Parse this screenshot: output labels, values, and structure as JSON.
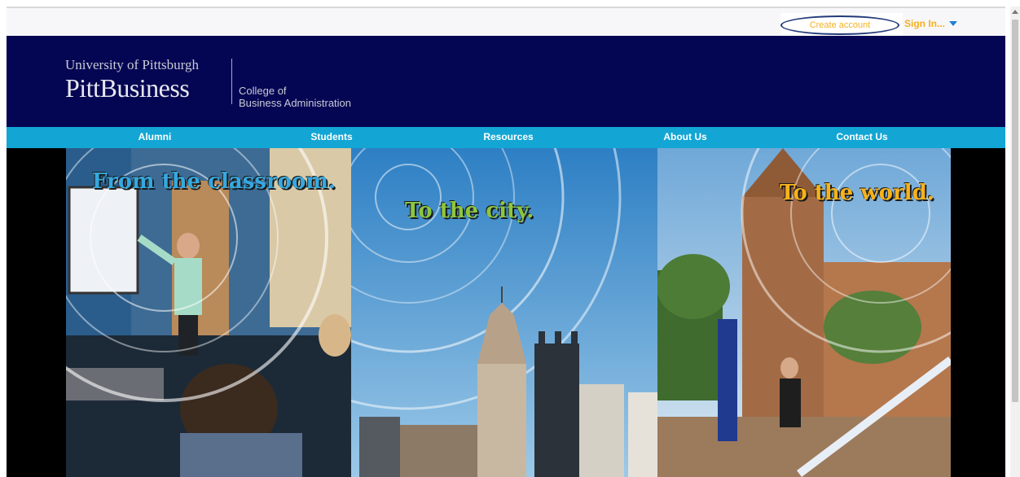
{
  "account": {
    "create_account_label": "Create account",
    "sign_in_label": "Sign In...",
    "dropdown_icon": "caret-down-icon"
  },
  "header": {
    "university": "University of Pittsburgh",
    "brand": "PittBusiness",
    "college_line1": "College of",
    "college_line2": "Business Administration"
  },
  "nav": {
    "items": [
      {
        "label": "Alumni"
      },
      {
        "label": "Students"
      },
      {
        "label": "Resources"
      },
      {
        "label": "About Us"
      },
      {
        "label": "Contact Us"
      }
    ]
  },
  "hero": {
    "panel1_text": "From the classroom.",
    "panel2_text": "To the city.",
    "panel3_text": "To the world."
  },
  "colors": {
    "header_bg": "#050653",
    "nav_bg": "#13a6d4",
    "accent_gold": "#f5b01f",
    "panel1_text": "#35a9e0",
    "panel2_text": "#8cc63f",
    "panel3_text": "#f6b21b"
  }
}
